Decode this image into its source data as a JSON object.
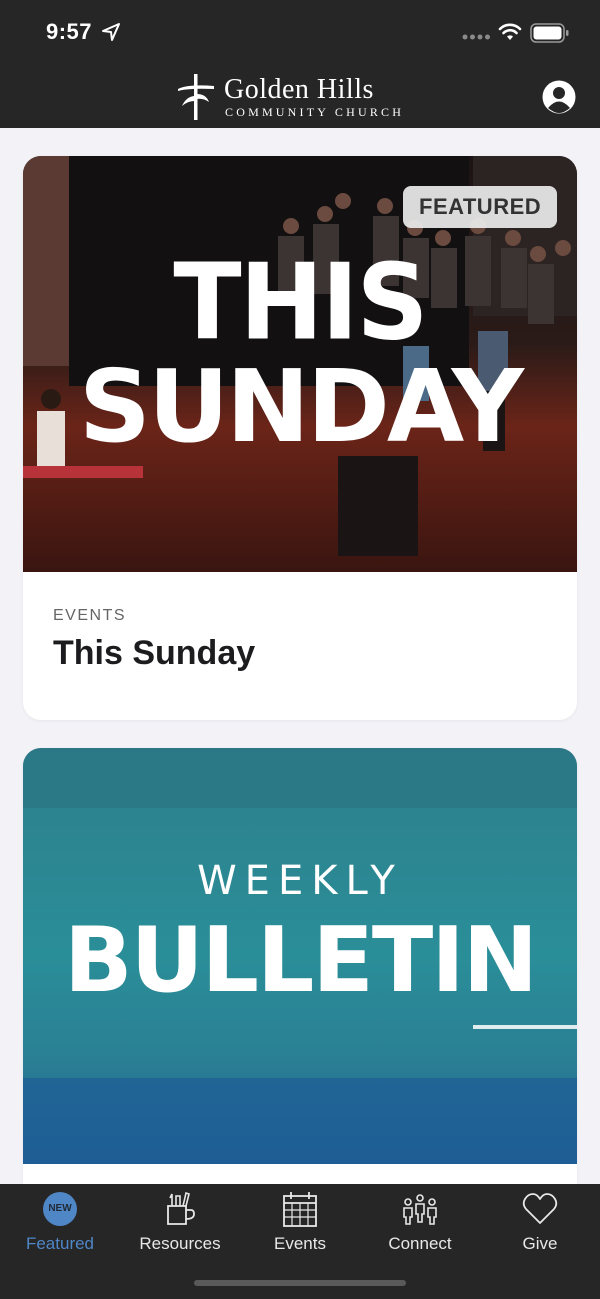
{
  "status": {
    "time": "9:57"
  },
  "header": {
    "logo_title": "Golden Hills",
    "logo_subtitle": "COMMUNITY CHURCH"
  },
  "cards": [
    {
      "image_text_line1": "THIS",
      "image_text_line2": "SUNDAY",
      "badge": "FEATURED",
      "category": "EVENTS",
      "title": "This Sunday"
    },
    {
      "image_text_line1": "WEEKLY",
      "image_text_line2": "BULLETIN"
    }
  ],
  "tabs": [
    {
      "label": "Featured",
      "icon": "new-badge-icon",
      "badge": "NEW",
      "active": true
    },
    {
      "label": "Resources",
      "icon": "resources-icon",
      "active": false
    },
    {
      "label": "Events",
      "icon": "calendar-icon",
      "active": false
    },
    {
      "label": "Connect",
      "icon": "people-icon",
      "active": false
    },
    {
      "label": "Give",
      "icon": "heart-icon",
      "active": false
    }
  ],
  "colors": {
    "header_bg": "#262626",
    "page_bg": "#f2f2f7",
    "active_tab": "#4f86c6",
    "bulletin_teal": "#2b8a95"
  }
}
